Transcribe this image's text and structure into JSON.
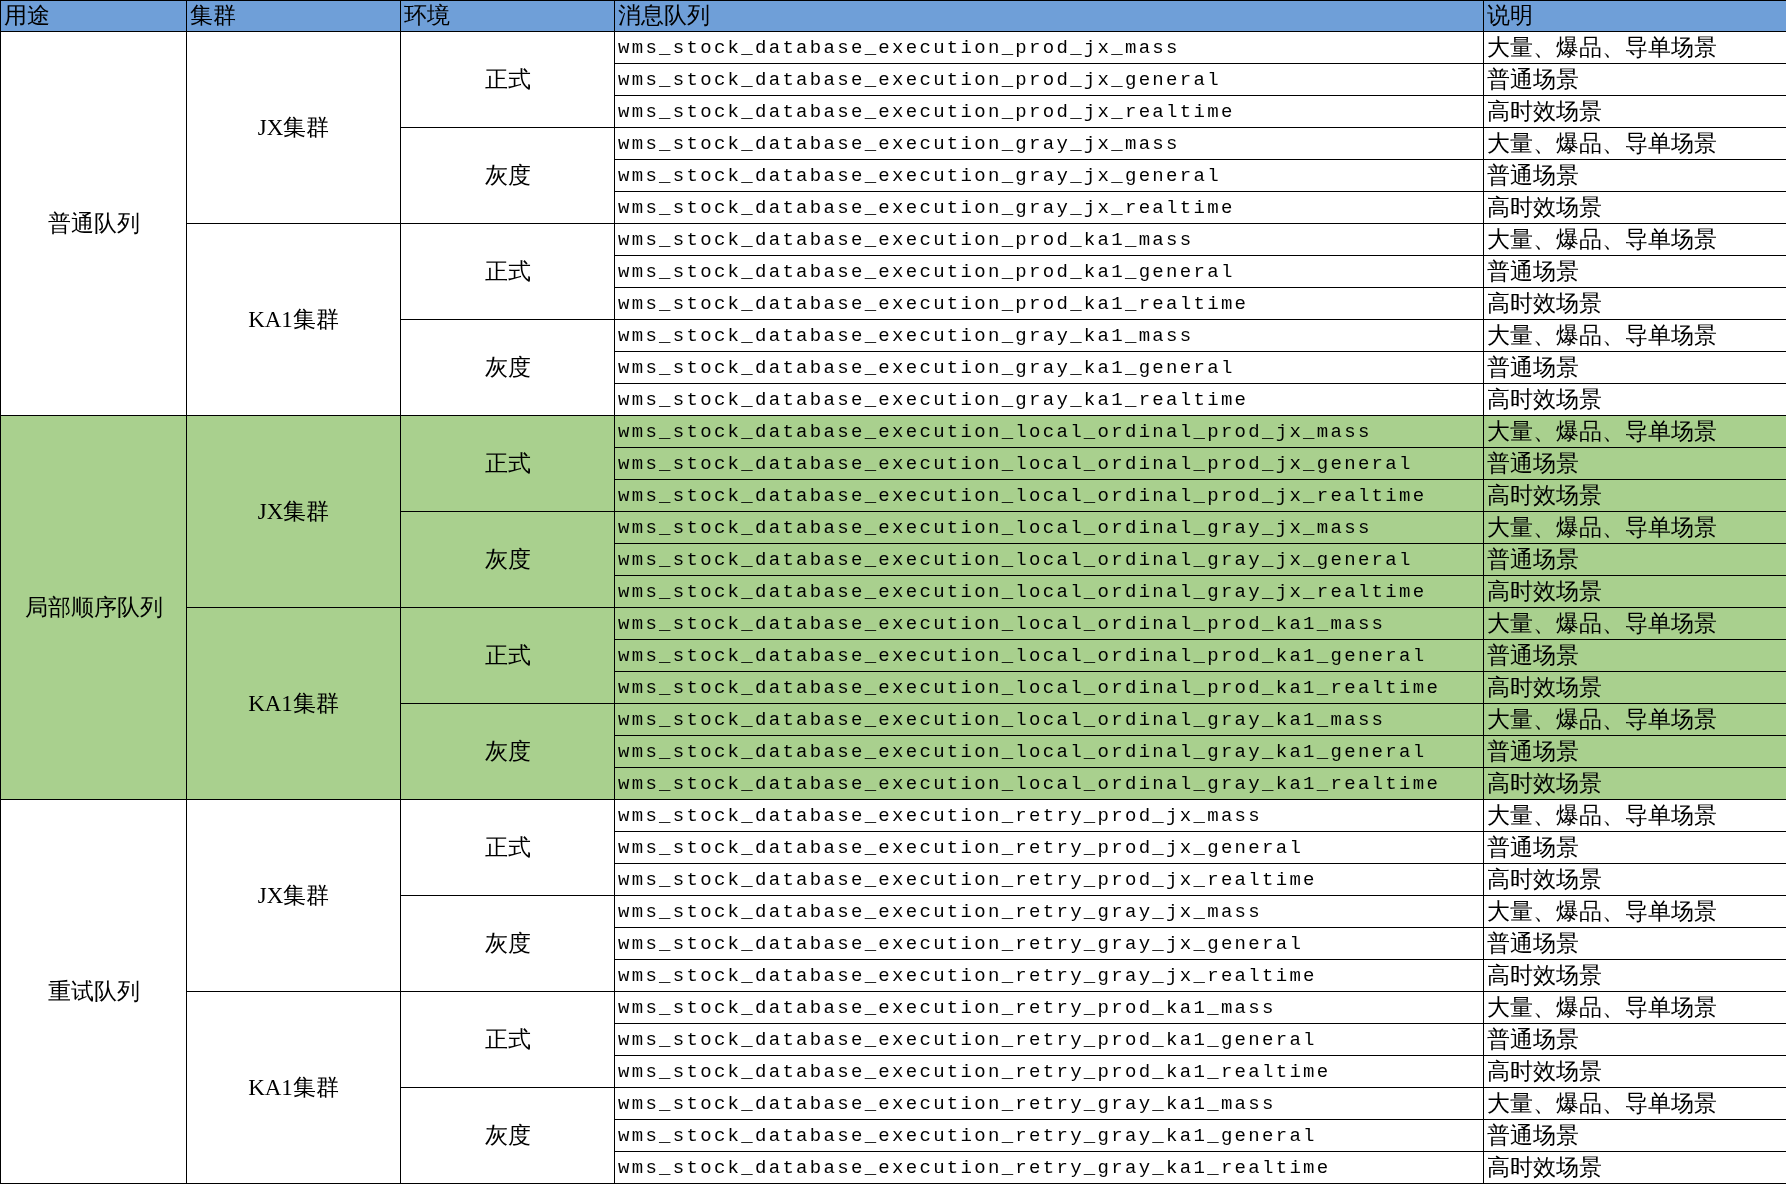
{
  "table": {
    "columns": [
      "用途",
      "集群",
      "环境",
      "消息队列",
      "说明"
    ],
    "groups": [
      {
        "purpose": "普通队列",
        "highlighted": false,
        "clusters": [
          {
            "name": "JX集群",
            "envs": [
              {
                "name": "正式",
                "rows": [
                  {
                    "queue": "wms_stock_database_execution_prod_jx_mass",
                    "note": "大量、爆品、导单场景"
                  },
                  {
                    "queue": "wms_stock_database_execution_prod_jx_general",
                    "note": "普通场景"
                  },
                  {
                    "queue": "wms_stock_database_execution_prod_jx_realtime",
                    "note": "高时效场景"
                  }
                ]
              },
              {
                "name": "灰度",
                "rows": [
                  {
                    "queue": "wms_stock_database_execution_gray_jx_mass",
                    "note": "大量、爆品、导单场景"
                  },
                  {
                    "queue": "wms_stock_database_execution_gray_jx_general",
                    "note": "普通场景"
                  },
                  {
                    "queue": "wms_stock_database_execution_gray_jx_realtime",
                    "note": "高时效场景"
                  }
                ]
              }
            ]
          },
          {
            "name": "KA1集群",
            "envs": [
              {
                "name": "正式",
                "rows": [
                  {
                    "queue": "wms_stock_database_execution_prod_ka1_mass",
                    "note": "大量、爆品、导单场景"
                  },
                  {
                    "queue": "wms_stock_database_execution_prod_ka1_general",
                    "note": "普通场景"
                  },
                  {
                    "queue": "wms_stock_database_execution_prod_ka1_realtime",
                    "note": "高时效场景"
                  }
                ]
              },
              {
                "name": "灰度",
                "rows": [
                  {
                    "queue": "wms_stock_database_execution_gray_ka1_mass",
                    "note": "大量、爆品、导单场景"
                  },
                  {
                    "queue": "wms_stock_database_execution_gray_ka1_general",
                    "note": "普通场景"
                  },
                  {
                    "queue": "wms_stock_database_execution_gray_ka1_realtime",
                    "note": "高时效场景"
                  }
                ]
              }
            ]
          }
        ]
      },
      {
        "purpose": "局部顺序队列",
        "highlighted": true,
        "clusters": [
          {
            "name": "JX集群",
            "envs": [
              {
                "name": "正式",
                "rows": [
                  {
                    "queue": "wms_stock_database_execution_local_ordinal_prod_jx_mass",
                    "note": "大量、爆品、导单场景"
                  },
                  {
                    "queue": "wms_stock_database_execution_local_ordinal_prod_jx_general",
                    "note": "普通场景"
                  },
                  {
                    "queue": "wms_stock_database_execution_local_ordinal_prod_jx_realtime",
                    "note": "高时效场景"
                  }
                ]
              },
              {
                "name": "灰度",
                "rows": [
                  {
                    "queue": "wms_stock_database_execution_local_ordinal_gray_jx_mass",
                    "note": "大量、爆品、导单场景"
                  },
                  {
                    "queue": "wms_stock_database_execution_local_ordinal_gray_jx_general",
                    "note": "普通场景"
                  },
                  {
                    "queue": "wms_stock_database_execution_local_ordinal_gray_jx_realtime",
                    "note": "高时效场景"
                  }
                ]
              }
            ]
          },
          {
            "name": "KA1集群",
            "envs": [
              {
                "name": "正式",
                "rows": [
                  {
                    "queue": "wms_stock_database_execution_local_ordinal_prod_ka1_mass",
                    "note": "大量、爆品、导单场景"
                  },
                  {
                    "queue": "wms_stock_database_execution_local_ordinal_prod_ka1_general",
                    "note": "普通场景"
                  },
                  {
                    "queue": "wms_stock_database_execution_local_ordinal_prod_ka1_realtime",
                    "note": "高时效场景"
                  }
                ]
              },
              {
                "name": "灰度",
                "rows": [
                  {
                    "queue": "wms_stock_database_execution_local_ordinal_gray_ka1_mass",
                    "note": "大量、爆品、导单场景"
                  },
                  {
                    "queue": "wms_stock_database_execution_local_ordinal_gray_ka1_general",
                    "note": "普通场景"
                  },
                  {
                    "queue": "wms_stock_database_execution_local_ordinal_gray_ka1_realtime",
                    "note": "高时效场景"
                  }
                ]
              }
            ]
          }
        ]
      },
      {
        "purpose": "重试队列",
        "highlighted": false,
        "clusters": [
          {
            "name": "JX集群",
            "envs": [
              {
                "name": "正式",
                "rows": [
                  {
                    "queue": "wms_stock_database_execution_retry_prod_jx_mass",
                    "note": "大量、爆品、导单场景"
                  },
                  {
                    "queue": "wms_stock_database_execution_retry_prod_jx_general",
                    "note": "普通场景"
                  },
                  {
                    "queue": "wms_stock_database_execution_retry_prod_jx_realtime",
                    "note": "高时效场景"
                  }
                ]
              },
              {
                "name": "灰度",
                "rows": [
                  {
                    "queue": "wms_stock_database_execution_retry_gray_jx_mass",
                    "note": "大量、爆品、导单场景"
                  },
                  {
                    "queue": "wms_stock_database_execution_retry_gray_jx_general",
                    "note": "普通场景"
                  },
                  {
                    "queue": "wms_stock_database_execution_retry_gray_jx_realtime",
                    "note": "高时效场景"
                  }
                ]
              }
            ]
          },
          {
            "name": "KA1集群",
            "envs": [
              {
                "name": "正式",
                "rows": [
                  {
                    "queue": "wms_stock_database_execution_retry_prod_ka1_mass",
                    "note": "大量、爆品、导单场景"
                  },
                  {
                    "queue": "wms_stock_database_execution_retry_prod_ka1_general",
                    "note": "普通场景"
                  },
                  {
                    "queue": "wms_stock_database_execution_retry_prod_ka1_realtime",
                    "note": "高时效场景"
                  }
                ]
              },
              {
                "name": "灰度",
                "rows": [
                  {
                    "queue": "wms_stock_database_execution_retry_gray_ka1_mass",
                    "note": "大量、爆品、导单场景"
                  },
                  {
                    "queue": "wms_stock_database_execution_retry_gray_ka1_general",
                    "note": "普通场景"
                  },
                  {
                    "queue": "wms_stock_database_execution_retry_gray_ka1_realtime",
                    "note": "高时效场景"
                  }
                ]
              }
            ]
          }
        ]
      }
    ]
  }
}
